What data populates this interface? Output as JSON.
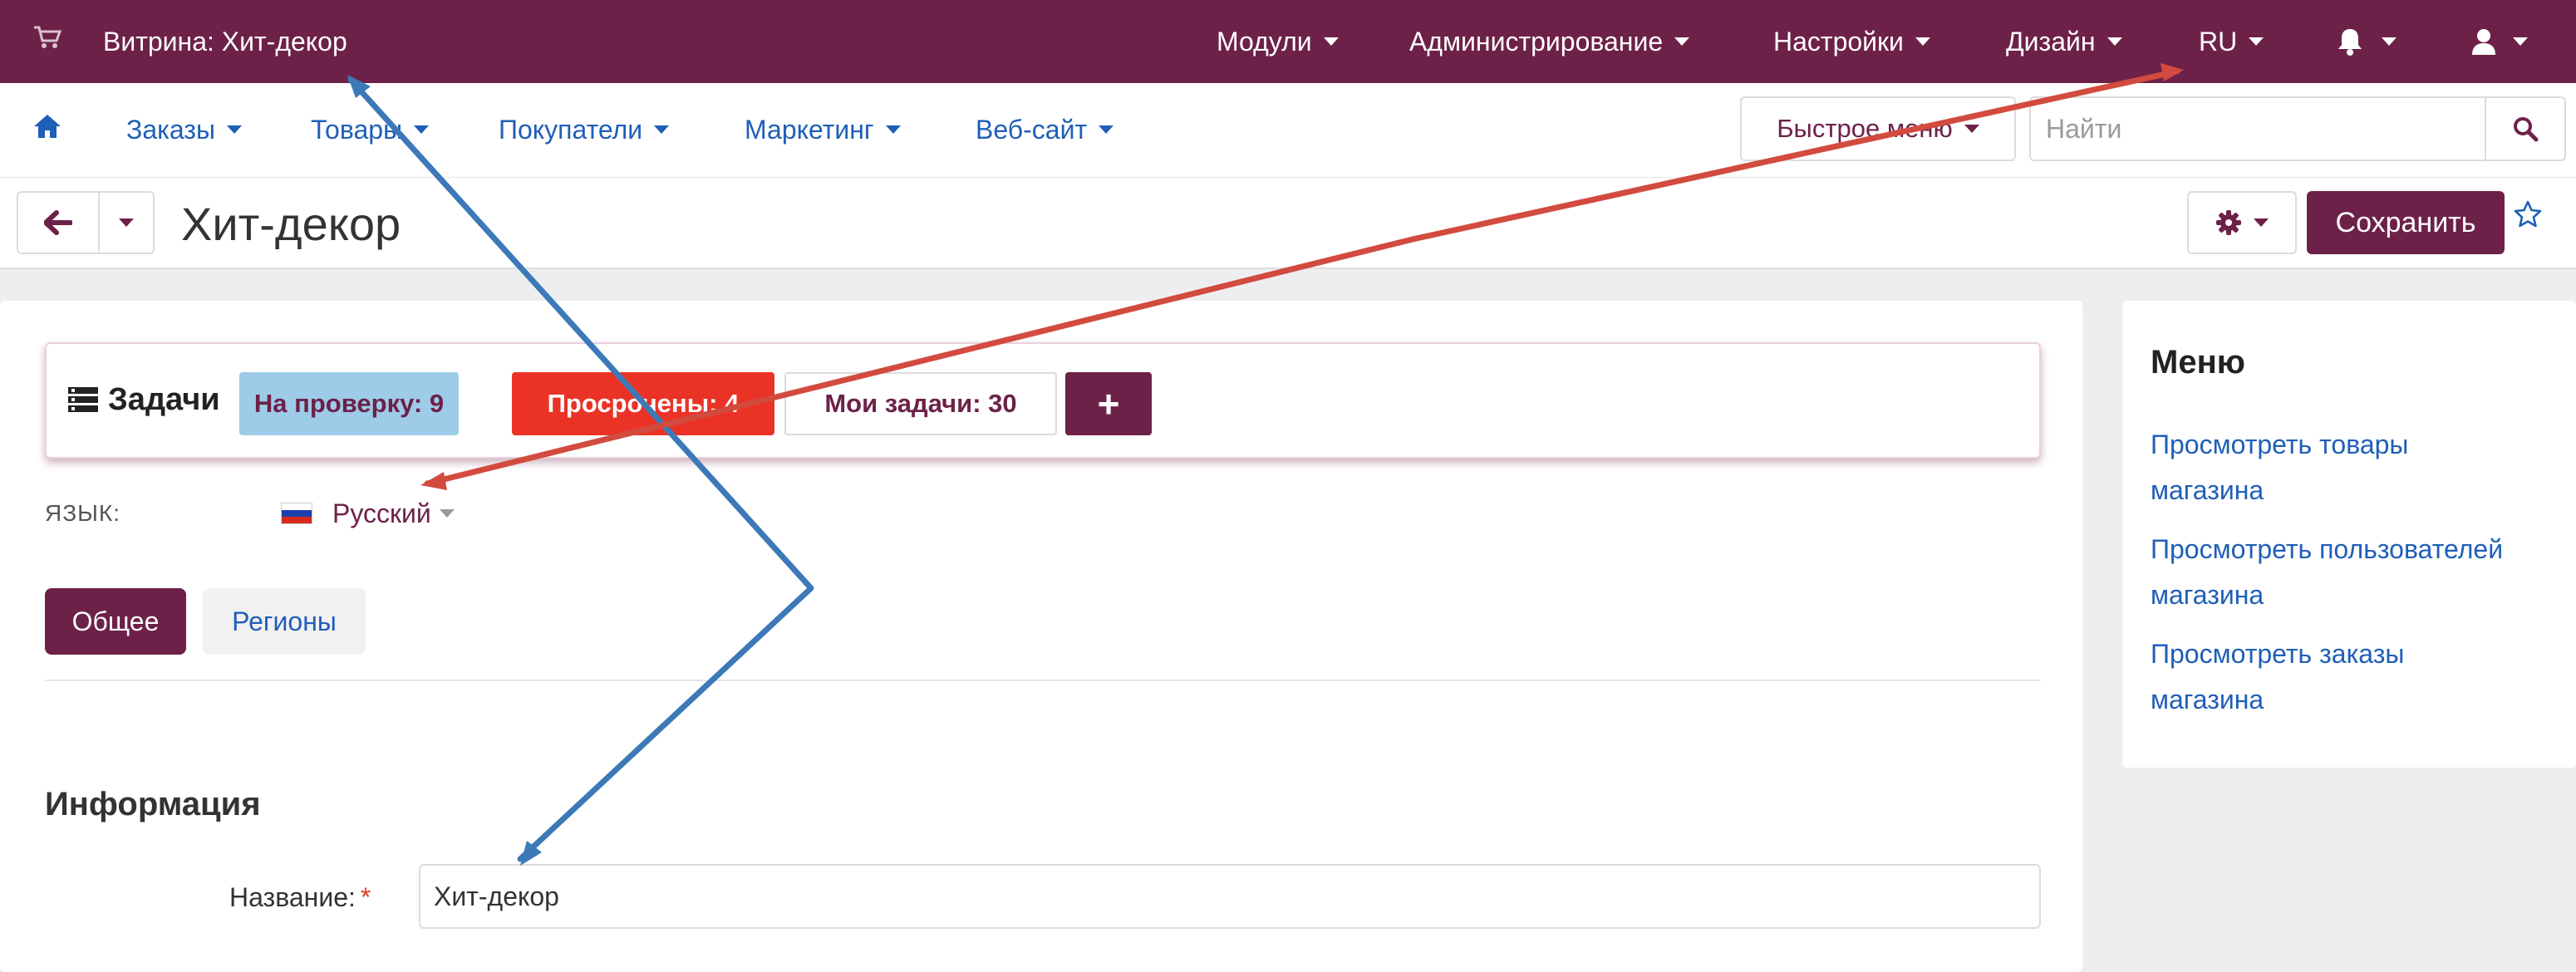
{
  "topbar": {
    "store_title": "Витрина: Хит-декор",
    "menus": [
      "Модули",
      "Администрирование",
      "Настройки",
      "Дизайн",
      "RU"
    ],
    "icons": [
      "cart-icon",
      "bell-icon",
      "user-icon"
    ]
  },
  "nav": {
    "items": [
      "Заказы",
      "Товары",
      "Покупатели",
      "Маркетинг",
      "Веб-сайт"
    ],
    "quick_menu": "Быстрое меню",
    "search_placeholder": "Найти",
    "icons": [
      "home-icon",
      "search-icon"
    ]
  },
  "page": {
    "title": "Хит-декор",
    "save_label": "Сохранить",
    "icons": [
      "arrow-left-icon",
      "gear-icon",
      "star-icon"
    ]
  },
  "tasks": {
    "title": "Задачи",
    "review": "На проверку: 9",
    "overdue": "Просрочены: 4",
    "mine": "Мои задачи: 30",
    "add": "+"
  },
  "language": {
    "label": "ЯЗЫК:",
    "value": "Русский"
  },
  "tabs": [
    "Общее",
    "Регионы"
  ],
  "section": {
    "title": "Информация",
    "name_label": "Название:",
    "required_mark": "*",
    "name_value": "Хит-декор"
  },
  "sidebar": {
    "title": "Меню",
    "links": [
      [
        "Просмотреть товары",
        "магазина"
      ],
      [
        "Просмотреть пользователей",
        "магазина"
      ],
      [
        "Просмотреть заказы",
        "магазина"
      ]
    ]
  },
  "colors": {
    "brand": "#6d2148",
    "link": "#1f5fb8",
    "danger": "#ea3326",
    "info": "#9dcbe8",
    "annotation_blue": "#3d79b8",
    "annotation_red": "#d24b3e"
  }
}
